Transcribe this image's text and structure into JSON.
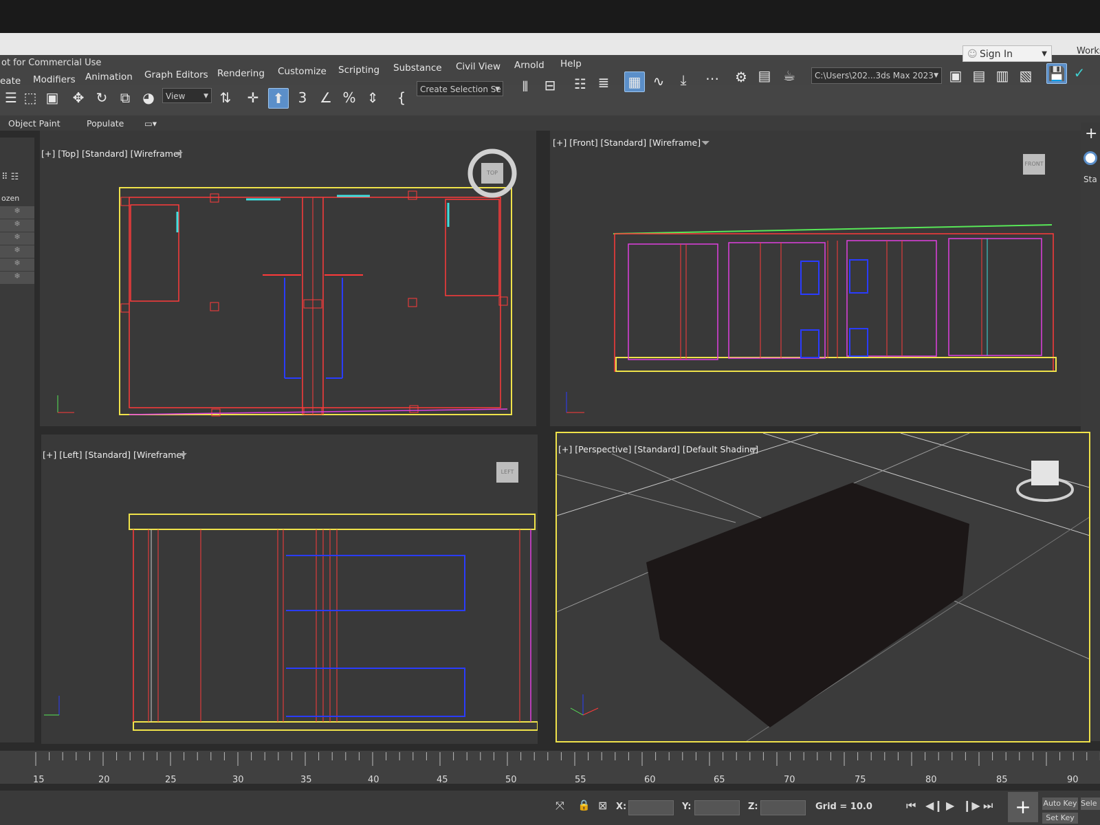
{
  "window": {
    "title": "ot for Commercial Use",
    "sign_in": "Sign In",
    "workspace": "Works",
    "path": "C:\\Users\\202...3ds Max 2023"
  },
  "menu": [
    "eate",
    "Modifiers",
    "Animation",
    "Graph Editors",
    "Rendering",
    "Customize",
    "Scripting",
    "Substance",
    "Civil View",
    "Arnold",
    "Help"
  ],
  "toolbar": {
    "view_dropdown": "View",
    "selection_set": "Create Selection Se"
  },
  "ribbon": {
    "object_paint": "Object Paint",
    "populate": "Populate"
  },
  "left_panel": {
    "frozen_label": "ozen"
  },
  "right_panel": {
    "tab_label": "Sta"
  },
  "viewports": {
    "top": {
      "label": "[+] [Top] [Standard] [Wireframe]",
      "cube": "TOP"
    },
    "front": {
      "label": "[+] [Front] [Standard] [Wireframe]",
      "cube": "FRONT"
    },
    "left": {
      "label": "[+] [Left] [Standard] [Wireframe]",
      "cube": "LEFT"
    },
    "perspective": {
      "label": "[+] [Perspective] [Standard] [Default Shading]"
    }
  },
  "timeline": {
    "ticks": [
      "15",
      "20",
      "25",
      "30",
      "35",
      "40",
      "45",
      "50",
      "55",
      "60",
      "65",
      "70",
      "75",
      "80",
      "85",
      "90"
    ]
  },
  "status": {
    "x_label": "X:",
    "y_label": "Y:",
    "z_label": "Z:",
    "grid": "Grid = 10.0",
    "auto_key": "Auto Key",
    "set_key": "Set Key",
    "select": "Sele"
  },
  "colors": {
    "accent": "#5b8fc9",
    "selection_yellow": "#f0e34a",
    "wire_red": "#ff3b3b",
    "wire_blue": "#2a3cff",
    "wire_magenta": "#e040e0",
    "wire_green": "#58e858",
    "wire_cyan": "#40e0e0"
  }
}
